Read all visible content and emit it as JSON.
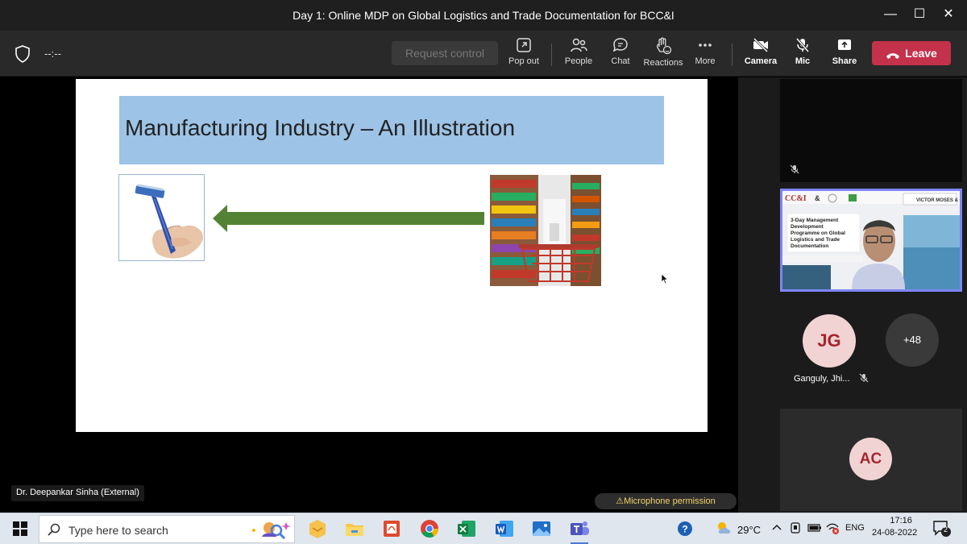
{
  "window": {
    "title": "Day 1: Online MDP on Global Logistics and Trade Documentation for BCC&I",
    "minimize": "—",
    "maximize": "☐",
    "close": "✕"
  },
  "toolbar": {
    "timer": "--:--",
    "request_control": "Request control",
    "pop_out": "Pop out",
    "people": "People",
    "chat": "Chat",
    "reactions": "Reactions",
    "more": "More",
    "camera": "Camera",
    "mic": "Mic",
    "share": "Share",
    "leave": "Leave"
  },
  "slide": {
    "title": "Manufacturing Industry – An Illustration"
  },
  "stage": {
    "presenter_name": "Dr. Deepankar Sinha (External)",
    "mic_permission": "⚠Microphone permission"
  },
  "participants": {
    "jg_initials": "JG",
    "jg_name": "Ganguly, Jhi...",
    "more_count": "+48",
    "ac_initials": "AC"
  },
  "taskbar": {
    "search_placeholder": "Type here to search",
    "temperature": "29°C",
    "language": "ENG",
    "time": "17:16",
    "date": "24-08-2022",
    "notifications": "2"
  },
  "colors": {
    "leave": "#c4314b",
    "slide_title_bar": "#9dc3e6",
    "arrow": "#548235",
    "active_border": "#7f85f5"
  }
}
